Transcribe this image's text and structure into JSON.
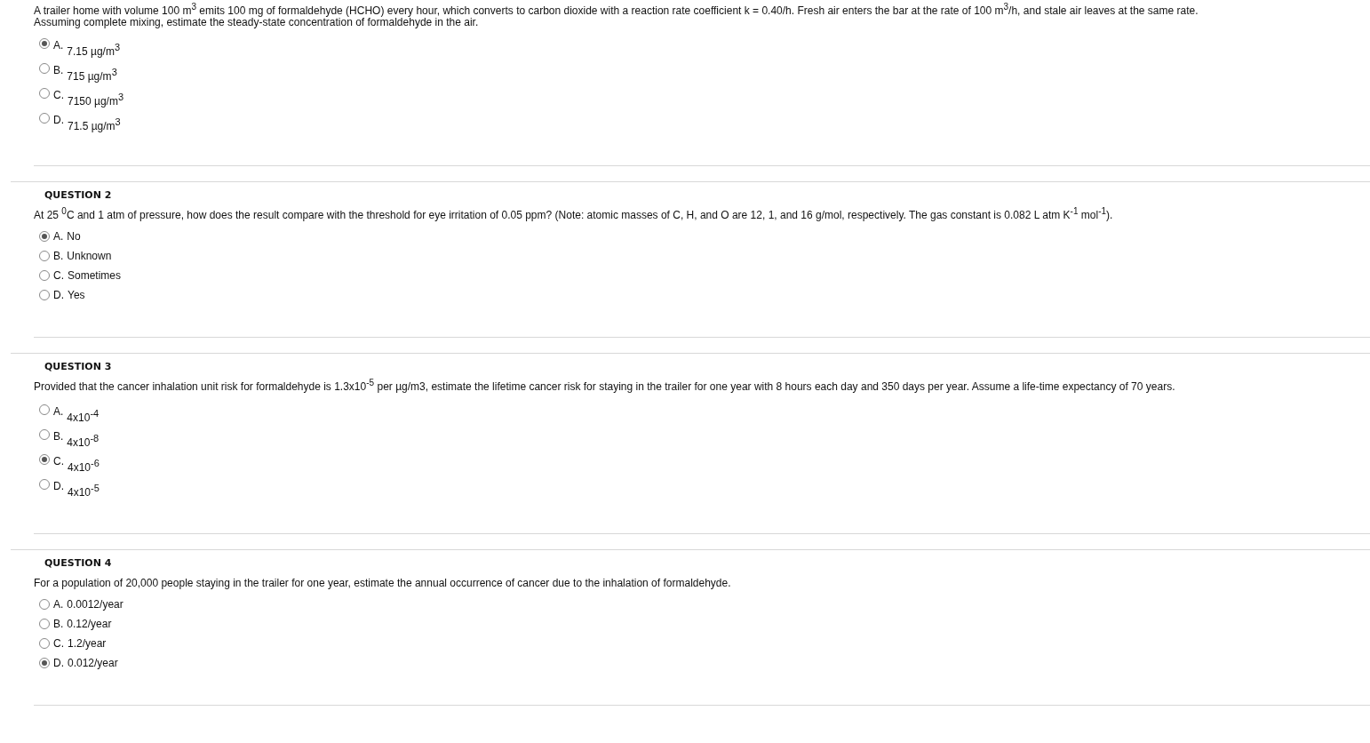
{
  "questions": [
    {
      "kind": "raised",
      "text": "A trailer home with volume 100 m$^{3}$ emits 100 mg of formaldehyde (HCHO) every hour, which converts to carbon dioxide with a reaction rate coefficient k = 0.40/h. Fresh air enters the bar at the rate of 100 m$^{3}$/h, and stale air leaves at the same rate.",
      "text_2": "Assuming complete mixing, estimate the steady-state concentration of formaldehyde in the air.",
      "options": [
        {
          "letter": "A.",
          "text": "7.15 µg/m$^{3}$",
          "selected": true
        },
        {
          "letter": "B.",
          "text": "715 µg/m$^{3}$",
          "selected": false
        },
        {
          "letter": "C.",
          "text": "7150 µg/m$^{3}$",
          "selected": false
        },
        {
          "letter": "D.",
          "text": "71.5 µg/m$^{3}$",
          "selected": false
        }
      ]
    },
    {
      "title": "QUESTION 2",
      "kind": "inline",
      "text": "At 25 $^{0}$C and 1 atm of pressure, how does the result compare with the threshold for eye irritation of 0.05 ppm? (Note: atomic masses of C, H, and O are 12, 1, and 16 g/mol, respectively. The gas constant is 0.082 L atm K$^{-1}$ mol$^{-1}$).",
      "options": [
        {
          "letter": "A.",
          "text": "No",
          "selected": true
        },
        {
          "letter": "B.",
          "text": "Unknown",
          "selected": false
        },
        {
          "letter": "C.",
          "text": "Sometimes",
          "selected": false
        },
        {
          "letter": "D.",
          "text": "Yes",
          "selected": false
        }
      ]
    },
    {
      "title": "QUESTION 3",
      "kind": "raised",
      "text": "Provided that the cancer inhalation unit risk for formaldehyde is 1.3x10$^{-5}$ per µg/m3, estimate the lifetime cancer risk for staying in the trailer for one year with 8 hours each day and 350 days per year. Assume a life-time expectancy of 70 years.",
      "options": [
        {
          "letter": "A.",
          "text": "4x10$^{-4}$",
          "selected": false
        },
        {
          "letter": "B.",
          "text": "4x10$^{-8}$",
          "selected": false
        },
        {
          "letter": "C.",
          "text": "4x10$^{-6}$",
          "selected": true
        },
        {
          "letter": "D.",
          "text": "4x10$^{-5}$",
          "selected": false
        }
      ]
    },
    {
      "title": "QUESTION 4",
      "kind": "inline",
      "text": "For a population of 20,000 people staying in the trailer for one year, estimate the annual occurrence of cancer due to the inhalation of formaldehyde.",
      "options": [
        {
          "letter": "A.",
          "text": "0.0012/year",
          "selected": false
        },
        {
          "letter": "B.",
          "text": "0.12/year",
          "selected": false
        },
        {
          "letter": "C.",
          "text": "1.2/year",
          "selected": false
        },
        {
          "letter": "D.",
          "text": "0.012/year",
          "selected": true
        }
      ]
    }
  ]
}
